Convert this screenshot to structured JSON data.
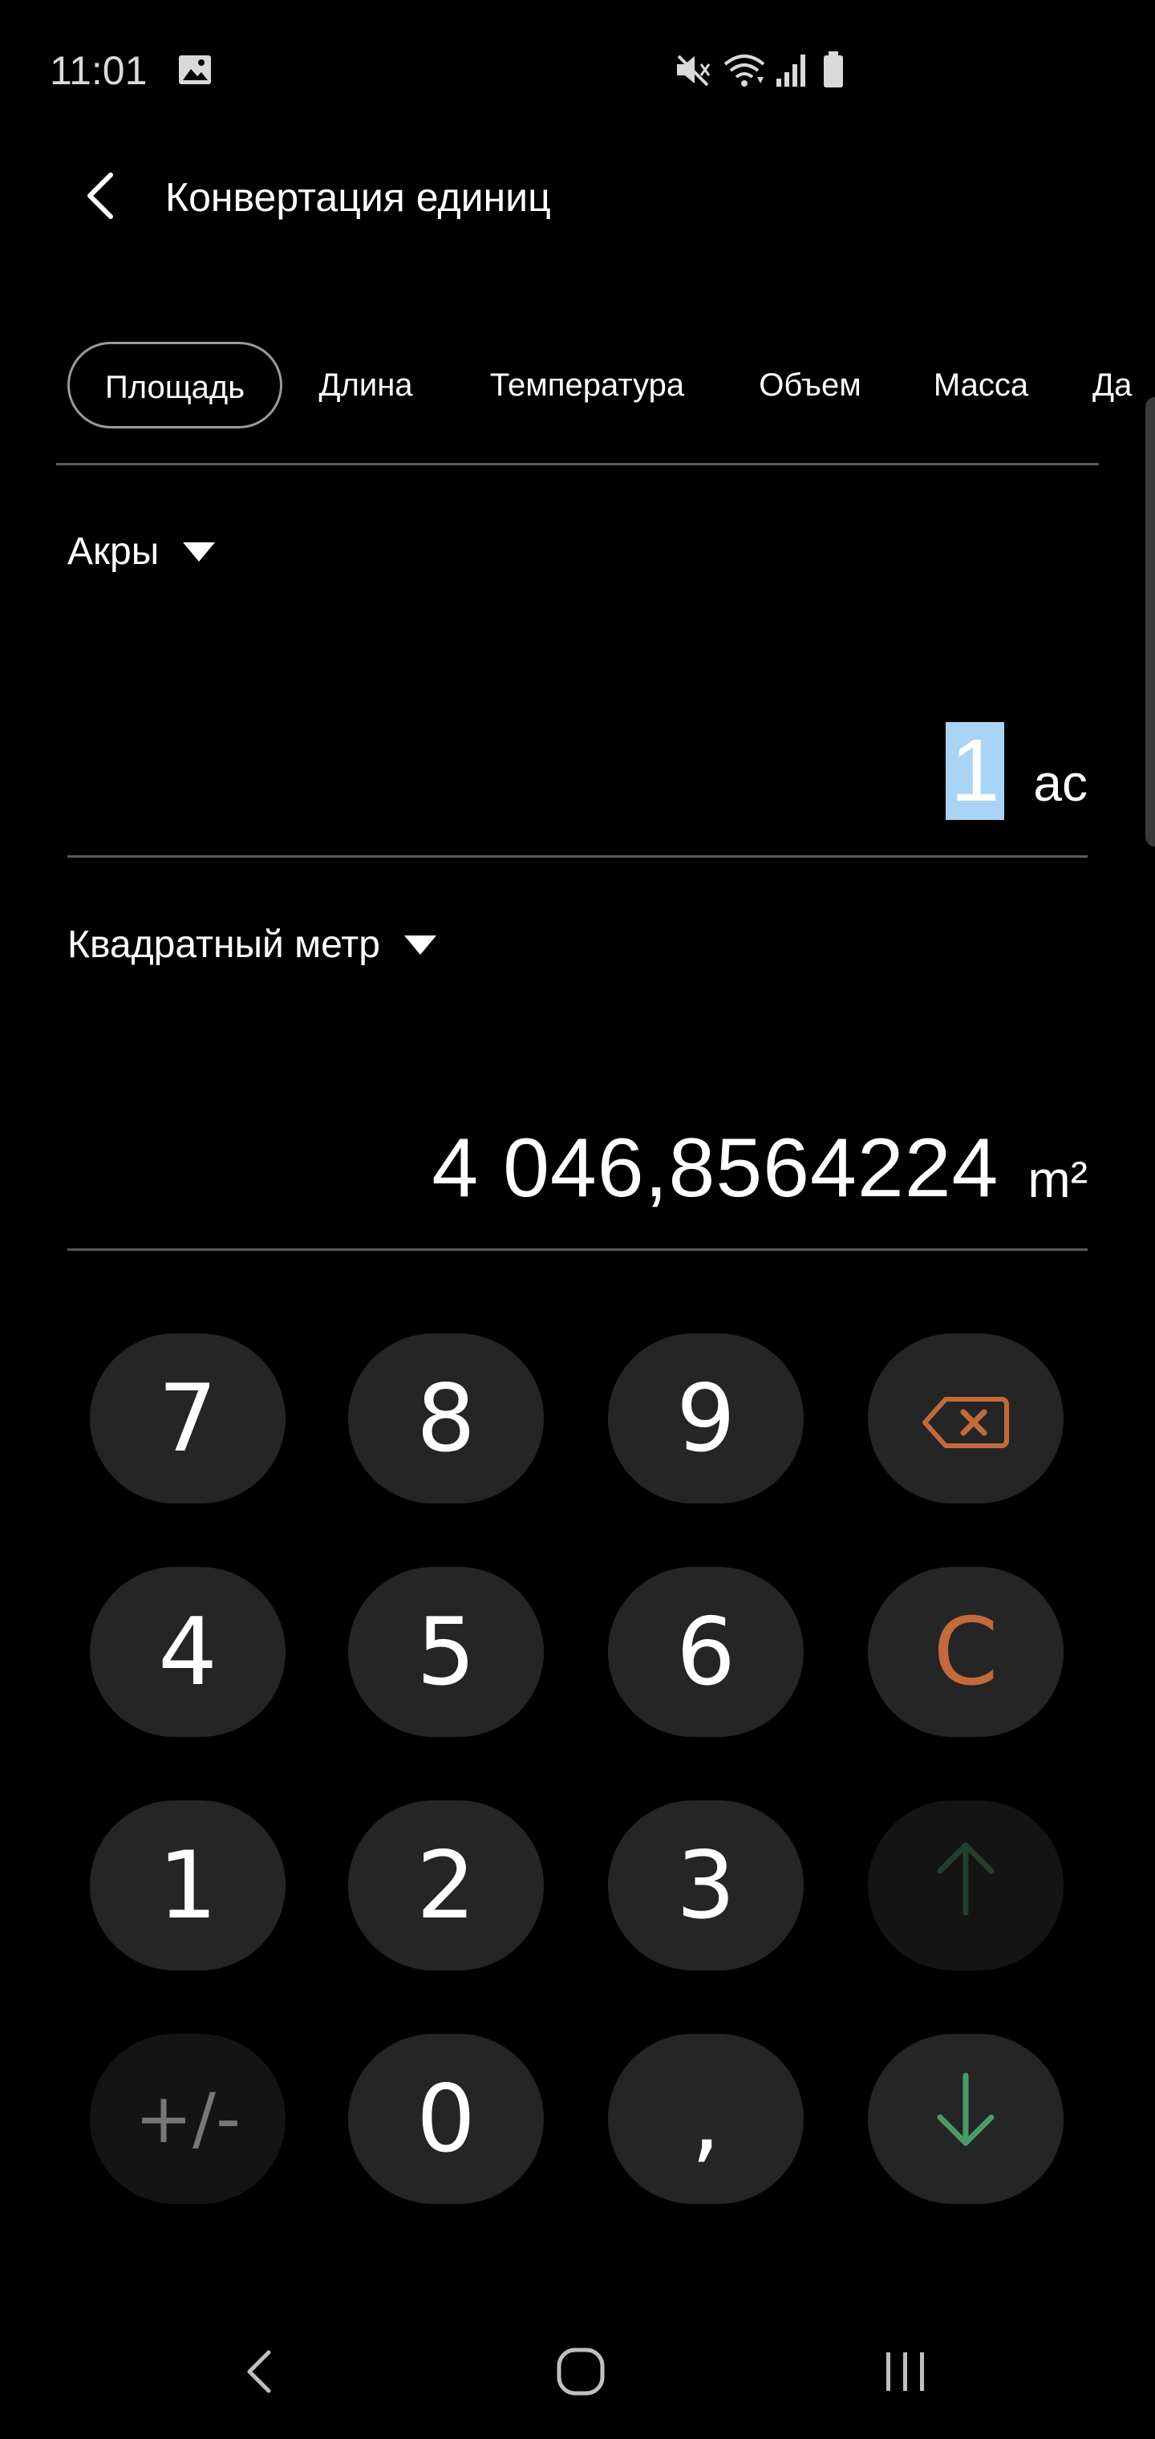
{
  "status_bar": {
    "time": "11:01",
    "icons": [
      "image-icon",
      "mute-icon",
      "wifi-icon",
      "signal-icon",
      "battery-icon"
    ]
  },
  "header": {
    "title": "Конвертация единиц"
  },
  "tabs": [
    {
      "label": "Площадь",
      "active": true
    },
    {
      "label": "Длина",
      "active": false
    },
    {
      "label": "Температура",
      "active": false
    },
    {
      "label": "Объем",
      "active": false
    },
    {
      "label": "Масса",
      "active": false
    },
    {
      "label": "Да",
      "active": false
    }
  ],
  "from": {
    "unit": "Акры",
    "value": "1",
    "unit_abbr": "ac"
  },
  "to": {
    "unit": "Квадратный метр",
    "value": "4 046,8564224",
    "unit_abbr": "m²"
  },
  "keypad": {
    "row1": [
      "7",
      "8",
      "9",
      "backspace-icon"
    ],
    "row2": [
      "4",
      "5",
      "6",
      "C"
    ],
    "row3": [
      "1",
      "2",
      "3",
      "arrow-up-icon"
    ],
    "row4": [
      "+/-",
      "0",
      ",",
      "arrow-down-icon"
    ]
  },
  "colors": {
    "background": "#000000",
    "key": "#252525",
    "key_dim": "#141414",
    "orange": "#c26a3a",
    "green": "#4a9a6a",
    "green_dim": "#23402e",
    "selection": "#aad4f5"
  }
}
